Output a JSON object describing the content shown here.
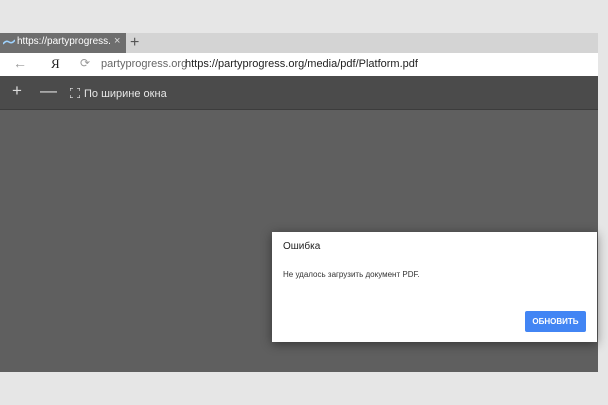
{
  "tab": {
    "title": "https://partyprogress.org",
    "close": "×"
  },
  "new_tab": "+",
  "address": {
    "back": "←",
    "yandex": "Я",
    "reload": "⟳",
    "domain": "partyprogress.org",
    "url": "https://partyprogress.org/media/pdf/Platform.pdf"
  },
  "pdf_toolbar": {
    "zoom_in": "+",
    "zoom_out": "—",
    "fit_width_label": "По ширине окна"
  },
  "dialog": {
    "title": "Ошибка",
    "message": "Не удалось загрузить документ PDF.",
    "button": "ОБНОВИТЬ"
  },
  "colors": {
    "accent": "#4285f4",
    "viewer_bg": "#5f5f5f",
    "toolbar_bg": "#4b4b4b"
  }
}
